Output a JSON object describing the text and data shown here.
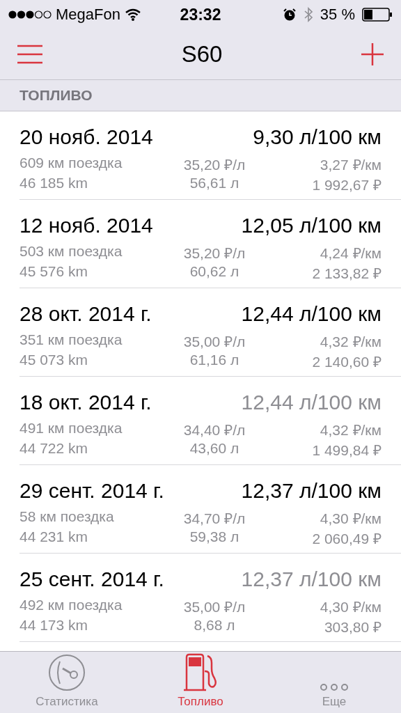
{
  "status_bar": {
    "carrier": "MegaFon",
    "time": "23:32",
    "battery": "35 %"
  },
  "nav": {
    "title": "S60"
  },
  "section": {
    "title": "ТОПЛИВО"
  },
  "entries": [
    {
      "date": "20 нояб. 2014",
      "consumption": "9,30 л/100 км",
      "greyed": false,
      "trip": "609 км поездка",
      "price": "35,20 ₽/л",
      "cost_per_km": "3,27 ₽/км",
      "odometer": "46 185 km",
      "volume": "56,61 л",
      "total": "1 992,67 ₽"
    },
    {
      "date": "12 нояб. 2014",
      "consumption": "12,05 л/100 км",
      "greyed": false,
      "trip": "503 км поездка",
      "price": "35,20 ₽/л",
      "cost_per_km": "4,24 ₽/км",
      "odometer": "45 576 km",
      "volume": "60,62 л",
      "total": "2 133,82 ₽"
    },
    {
      "date": "28 окт. 2014 г.",
      "consumption": "12,44 л/100 км",
      "greyed": false,
      "trip": "351 км поездка",
      "price": "35,00 ₽/л",
      "cost_per_km": "4,32 ₽/км",
      "odometer": "45 073 km",
      "volume": "61,16 л",
      "total": "2 140,60 ₽"
    },
    {
      "date": "18 окт. 2014 г.",
      "consumption": "12,44 л/100 км",
      "greyed": true,
      "trip": "491 км поездка",
      "price": "34,40 ₽/л",
      "cost_per_km": "4,32 ₽/км",
      "odometer": "44 722 km",
      "volume": "43,60 л",
      "total": "1 499,84 ₽"
    },
    {
      "date": "29 сент. 2014 г.",
      "consumption": "12,37 л/100 км",
      "greyed": false,
      "trip": "58 км поездка",
      "price": "34,70 ₽/л",
      "cost_per_km": "4,30 ₽/км",
      "odometer": "44 231 km",
      "volume": "59,38 л",
      "total": "2 060,49 ₽"
    },
    {
      "date": "25 сент. 2014 г.",
      "consumption": "12,37 л/100 км",
      "greyed": true,
      "trip": "492 км поездка",
      "price": "35,00 ₽/л",
      "cost_per_km": "4,30 ₽/км",
      "odometer": "44 173 km",
      "volume": "8,68 л",
      "total": "303,80 ₽"
    }
  ],
  "tab_bar": [
    {
      "kind": "stats",
      "label": "Статистика",
      "selected": false
    },
    {
      "kind": "fuel",
      "label": "Топливо",
      "selected": true
    },
    {
      "kind": "more",
      "label": "Еще",
      "selected": false
    }
  ]
}
